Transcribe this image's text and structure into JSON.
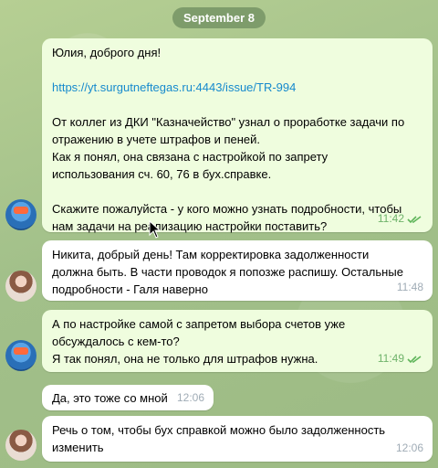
{
  "date_label": "September 8",
  "messages": [
    {
      "lines": [
        "Юлия, доброго дня!"
      ],
      "link": "https://yt.surgutneftegas.ru:4443/issue/TR-994",
      "para2": [
        "От коллег из ДКИ \"Казначейство\" узнал о проработке задачи по",
        "отражению в учете штрафов и пеней.",
        "Как я понял, она связана с настройкой по запрету",
        "использования сч. 60, 76 в бух.справке."
      ],
      "para3": [
        "Скажите пожалуйста - у кого можно узнать подробности, чтобы",
        "нам задачи на реализацию настройки поставить?"
      ],
      "time": "11:42"
    },
    {
      "lines": [
        "Никита, добрый день! Там корректировка задолженности",
        "должна быть. В части проводок я попозже распишу. Остальные",
        "подробности - Галя наверно"
      ],
      "time": "11:48"
    },
    {
      "lines": [
        "А по настройке самой с запретом выбора счетов уже",
        "обсуждалось с кем-то?",
        "Я так понял, она не только для штрафов нужна."
      ],
      "time": "11:49"
    },
    {
      "lines": [
        "Да, это тоже со мной"
      ],
      "time": "12:06"
    },
    {
      "lines": [
        "Речь о том, чтобы бух справкой можно было задолженность",
        "изменить"
      ],
      "time": "12:06"
    }
  ],
  "colors": {
    "outgoing_bubble": "#effdde",
    "incoming_bubble": "#ffffff",
    "link": "#168acd",
    "read_ticks": "#5fb55a"
  }
}
